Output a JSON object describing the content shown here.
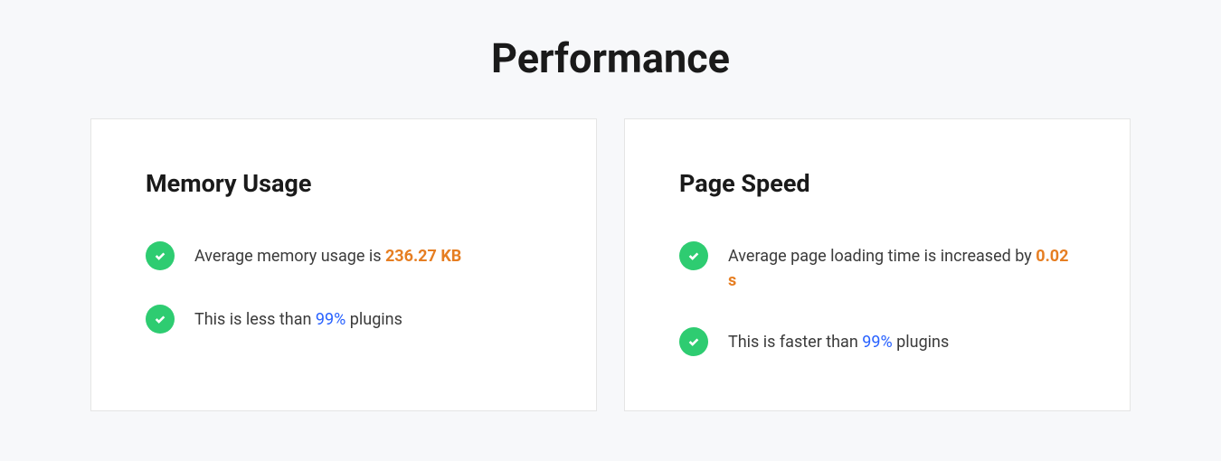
{
  "page": {
    "title": "Performance"
  },
  "cards": {
    "memory": {
      "title": "Memory Usage",
      "row1": {
        "prefix": "Average memory usage is ",
        "value": "236.27 KB"
      },
      "row2": {
        "prefix": "This is less than ",
        "value": "99%",
        "suffix": " plugins"
      }
    },
    "speed": {
      "title": "Page Speed",
      "row1": {
        "prefix": "Average page loading time is increased by ",
        "value": "0.02 s"
      },
      "row2": {
        "prefix": "This is faster than ",
        "value": "99%",
        "suffix": " plugins"
      }
    }
  }
}
